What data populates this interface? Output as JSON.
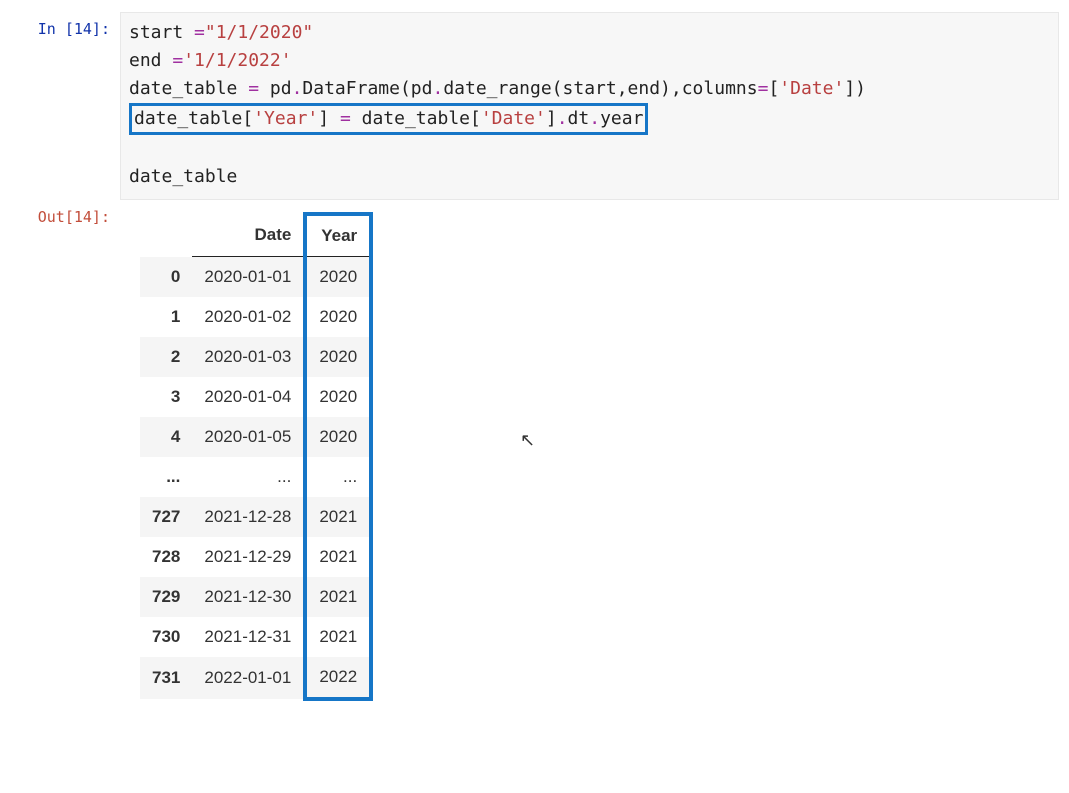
{
  "in_prompt": "In [14]:",
  "out_prompt": "Out[14]:",
  "code": {
    "assign1_target": "start ",
    "assign_eq": "=",
    "str_start": "\"1/1/2020\"",
    "assign2_target": "end ",
    "str_end": "'1/1/2022'",
    "line3_pre": "date_table ",
    "line3_call_a": " pd",
    "line3_call_b": "DataFrame(pd",
    "line3_call_c": "date_range(start,end),columns",
    "line3_list_open": "[",
    "str_date_col": "'Date'",
    "line3_list_close": "])",
    "line4_lhs_a": "date_table[",
    "str_year_col": "'Year'",
    "line4_lhs_b": "] ",
    "line4_rhs_a": " date_table[",
    "line4_rhs_b": "]",
    "line4_rhs_c": "dt",
    "line4_rhs_d": "year",
    "line6": "date_table"
  },
  "table": {
    "headers": {
      "index": "",
      "date": "Date",
      "year": "Year"
    },
    "rows": [
      {
        "idx": "0",
        "date": "2020-01-01",
        "year": "2020"
      },
      {
        "idx": "1",
        "date": "2020-01-02",
        "year": "2020"
      },
      {
        "idx": "2",
        "date": "2020-01-03",
        "year": "2020"
      },
      {
        "idx": "3",
        "date": "2020-01-04",
        "year": "2020"
      },
      {
        "idx": "4",
        "date": "2020-01-05",
        "year": "2020"
      },
      {
        "idx": "...",
        "date": "...",
        "year": "..."
      },
      {
        "idx": "727",
        "date": "2021-12-28",
        "year": "2021"
      },
      {
        "idx": "728",
        "date": "2021-12-29",
        "year": "2021"
      },
      {
        "idx": "729",
        "date": "2021-12-30",
        "year": "2021"
      },
      {
        "idx": "730",
        "date": "2021-12-31",
        "year": "2021"
      },
      {
        "idx": "731",
        "date": "2022-01-01",
        "year": "2022"
      }
    ]
  }
}
